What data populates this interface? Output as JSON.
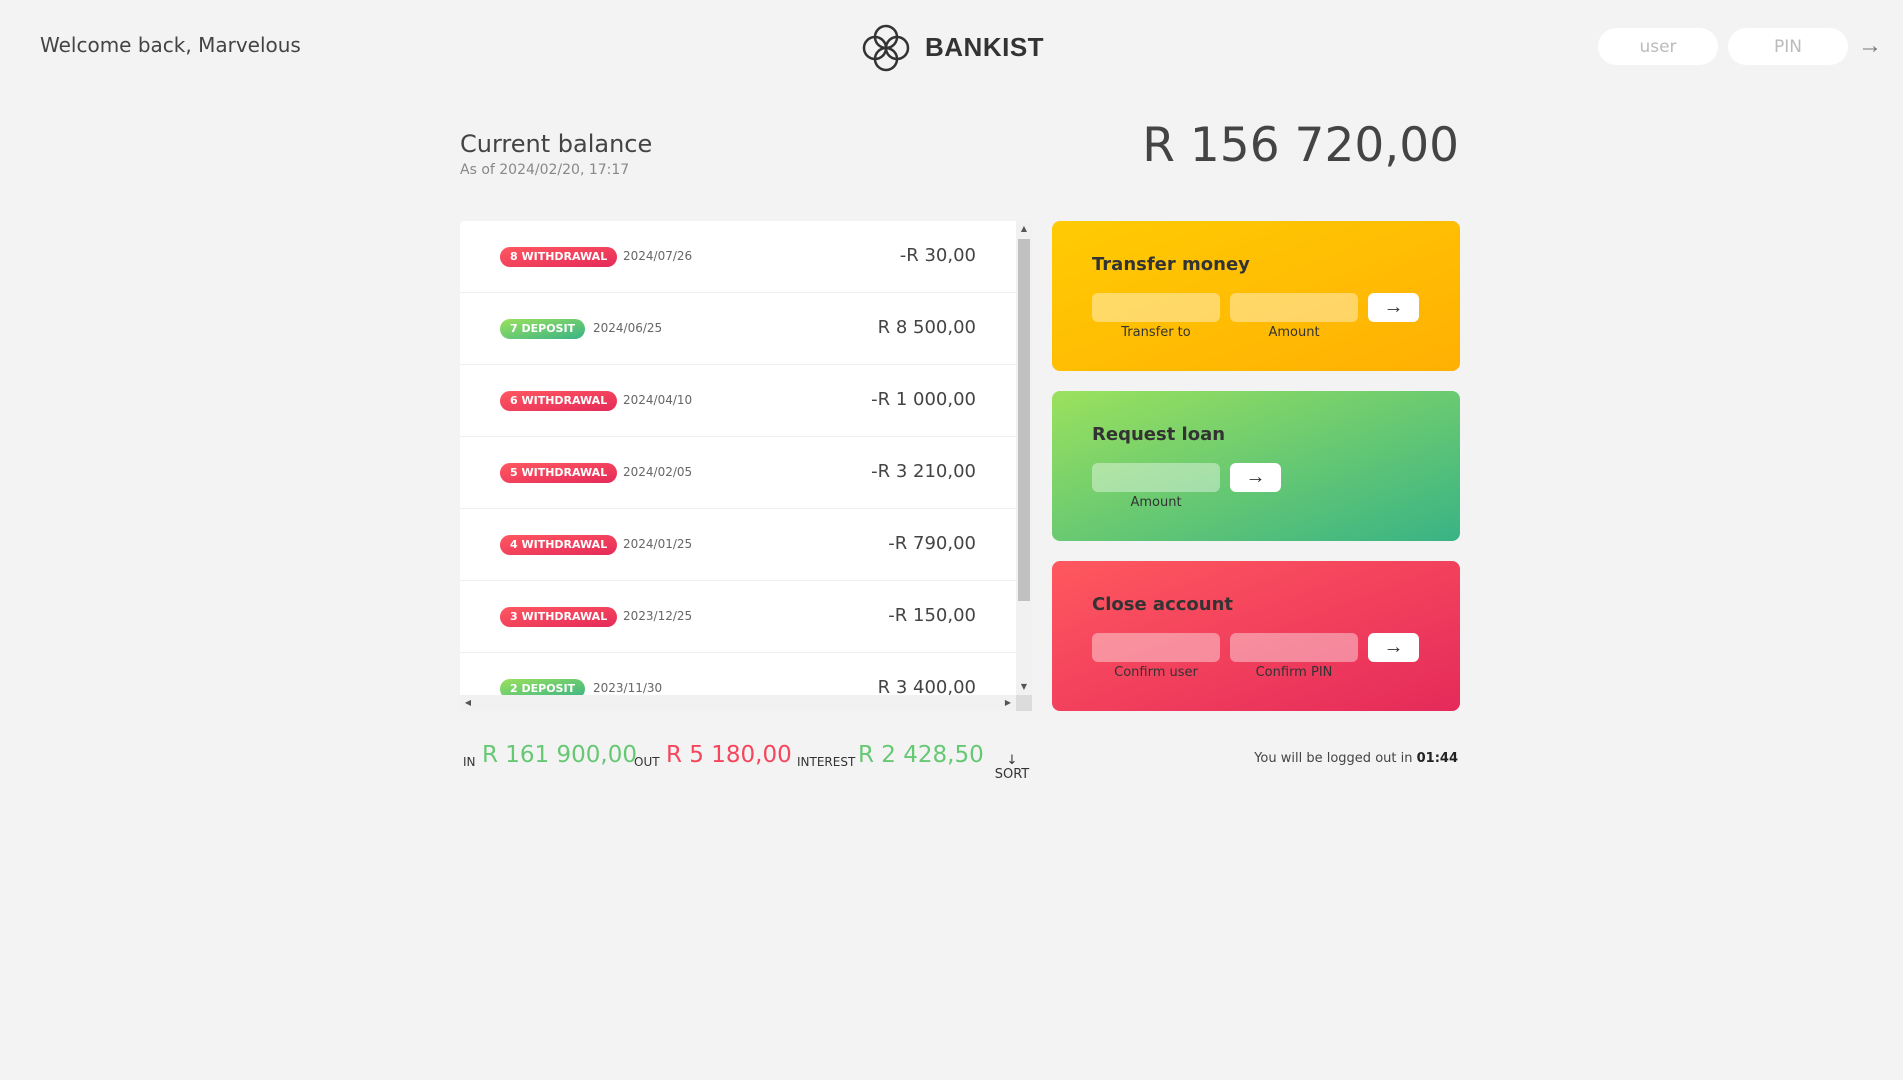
{
  "nav": {
    "welcome": "Welcome back, Marvelous",
    "brand": "BANKIST",
    "user_placeholder": "user",
    "pin_placeholder": "PIN",
    "login_arrow": "→"
  },
  "balance": {
    "title": "Current balance",
    "date": "As of 2024/02/20, 17:17",
    "value": "R 156 720,00"
  },
  "movements": [
    {
      "type_label": "8 WITHDRAWAL",
      "kind": "withdrawal",
      "date": "2024/07/26",
      "value": "-R 30,00"
    },
    {
      "type_label": "7 DEPOSIT",
      "kind": "deposit",
      "date": "2024/06/25",
      "value": "R 8 500,00"
    },
    {
      "type_label": "6 WITHDRAWAL",
      "kind": "withdrawal",
      "date": "2024/04/10",
      "value": "-R 1 000,00"
    },
    {
      "type_label": "5 WITHDRAWAL",
      "kind": "withdrawal",
      "date": "2024/02/05",
      "value": "-R 3 210,00"
    },
    {
      "type_label": "4 WITHDRAWAL",
      "kind": "withdrawal",
      "date": "2024/01/25",
      "value": "-R 790,00"
    },
    {
      "type_label": "3 WITHDRAWAL",
      "kind": "withdrawal",
      "date": "2023/12/25",
      "value": "-R 150,00"
    },
    {
      "type_label": "2 DEPOSIT",
      "kind": "deposit",
      "date": "2023/11/30",
      "value": "R 3 400,00"
    }
  ],
  "operations": {
    "transfer": {
      "title": "Transfer money",
      "label_to": "Transfer to",
      "label_amount": "Amount",
      "button": "→"
    },
    "loan": {
      "title": "Request loan",
      "label_amount": "Amount",
      "button": "→"
    },
    "close": {
      "title": "Close account",
      "label_user": "Confirm user",
      "label_pin": "Confirm PIN",
      "button": "→"
    }
  },
  "summary": {
    "in_label": "In",
    "in_value": "R 161 900,00",
    "out_label": "Out",
    "out_value": "R 5 180,00",
    "interest_label": "Interest",
    "interest_value": "R 2 428,50",
    "sort_arrow": "↓",
    "sort_label": "SORT"
  },
  "logout": {
    "prefix": "You will be logged out in",
    "timer": "01:44"
  },
  "colors": {
    "deposit": "#66c873",
    "withdrawal": "#f5465d",
    "transfer_bg": "#ffcb03",
    "loan_bg": "#39b385",
    "close_bg": "#ff585f"
  },
  "icons": {
    "logo": "bankist-logo-icon",
    "scroll_up": "triangle-up-icon",
    "scroll_down": "triangle-down-icon",
    "scroll_left": "triangle-left-icon",
    "scroll_right": "triangle-right-icon"
  }
}
